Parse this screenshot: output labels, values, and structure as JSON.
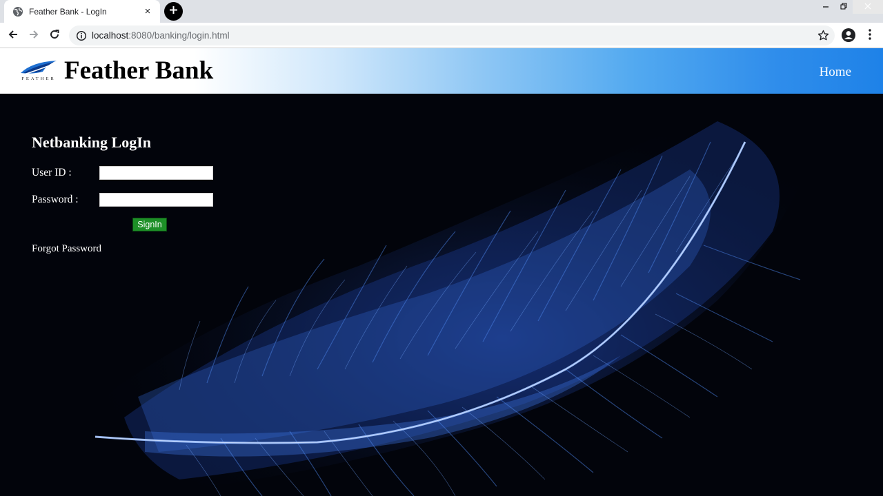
{
  "browser": {
    "tab_title": "Feather Bank - LogIn",
    "tab_close_icon": "×",
    "new_tab_icon": "+",
    "url_host": "localhost",
    "url_path": ":8080/banking/login.html"
  },
  "header": {
    "logo_text": "FEATHER",
    "brand_name": "Feather Bank",
    "home_link": "Home"
  },
  "login": {
    "title": "Netbanking LogIn",
    "user_id_label": "User ID :",
    "user_id_value": "",
    "password_label": "Password :",
    "password_value": "",
    "signin_label": "SignIn",
    "forgot_link": "Forgot Password"
  },
  "colors": {
    "header_gradient_end": "#1e82e8",
    "signin_button": "#1d8f27",
    "feather_blue": "#3c78d8",
    "page_background": "#02040b"
  }
}
